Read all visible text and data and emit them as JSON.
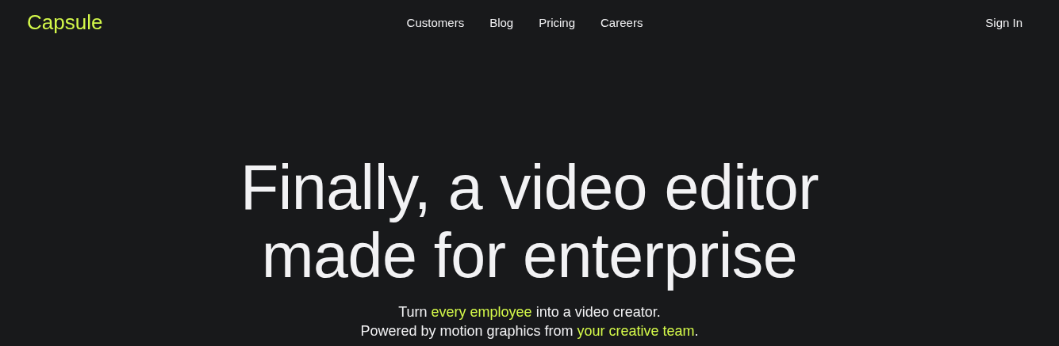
{
  "header": {
    "logo": "Capsule",
    "nav": [
      "Customers",
      "Blog",
      "Pricing",
      "Careers"
    ],
    "sign_in": "Sign In"
  },
  "hero": {
    "headline": [
      "Finally, a video editor",
      "made for enterprise"
    ],
    "subtitle": [
      {
        "before": "Turn ",
        "highlight": "every employee",
        "after": " into a video creator."
      },
      {
        "before": "Powered by motion graphics from ",
        "highlight": "your creative team",
        "after": "."
      }
    ]
  }
}
